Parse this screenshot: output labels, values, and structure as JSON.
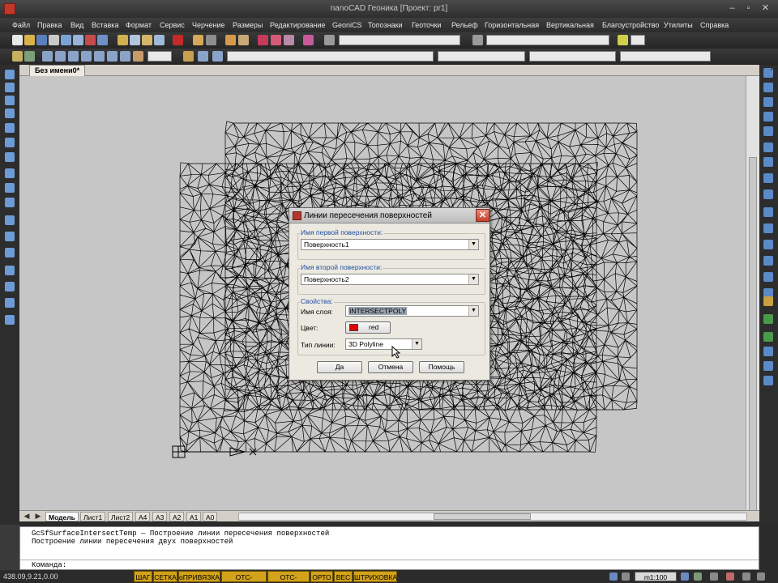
{
  "window": {
    "title": "nanoCAD Геоника [Проект: pr1]",
    "minimize_icon": "minimize-icon",
    "maximize_icon": "maximize-icon",
    "close_icon": "close-icon",
    "close_glyph": "✕"
  },
  "menu": [
    "Файл",
    "Правка",
    "Вид",
    "Вставка",
    "Формат",
    "Сервис",
    "Черчение",
    "Размеры",
    "Редактирование",
    "GeoniCS",
    "Топознаки",
    "Геоточки",
    "Рельеф",
    "Горизонтальная",
    "Вертикальная",
    "Благоустройство",
    "Утилиты",
    "Справка"
  ],
  "document": {
    "tab_title": "Без имени0*"
  },
  "layout_tabs": [
    "Модель",
    "Лист1",
    "Лист2",
    "A4",
    "A3",
    "A2",
    "A1",
    "A0"
  ],
  "command_line": {
    "lines": [
      "GcSfSurfaceIntersectTemp — Построение линии пересечения поверхностей",
      "Построение линии пересечения двух поверхностей"
    ],
    "prompt": "Команда:"
  },
  "status": {
    "coords": "438.09,9.21,0.00",
    "buttons": [
      "ШАГ",
      "СЕТКА",
      "оПРИВЯЗКА",
      "ОТС-ОБЪЕКТ",
      "ОТС-ПОЛЯР",
      "ОРТО",
      "ВЕС",
      "ШТРИХОВКА"
    ],
    "scale": "m1:100",
    "button_color": "#d2a21a"
  },
  "dialog": {
    "title": "Линии пересечения поверхностей",
    "group1": {
      "label": "Имя первой поверхности:",
      "value": "Поверхность1"
    },
    "group2": {
      "label": "Имя второй поверхности:",
      "value": "Поверхность2"
    },
    "props": {
      "label": "Свойства:",
      "layer_label": "Имя слоя:",
      "layer_value": "INTERSECTPOLY",
      "color_label": "Цвет:",
      "color_value": "red",
      "color_swatch": "#e00000",
      "linetype_label": "Тип линии:",
      "linetype_value": "3D Polyline"
    },
    "buttons": {
      "ok": "Да",
      "cancel": "Отмена",
      "help": "Помощь"
    }
  }
}
